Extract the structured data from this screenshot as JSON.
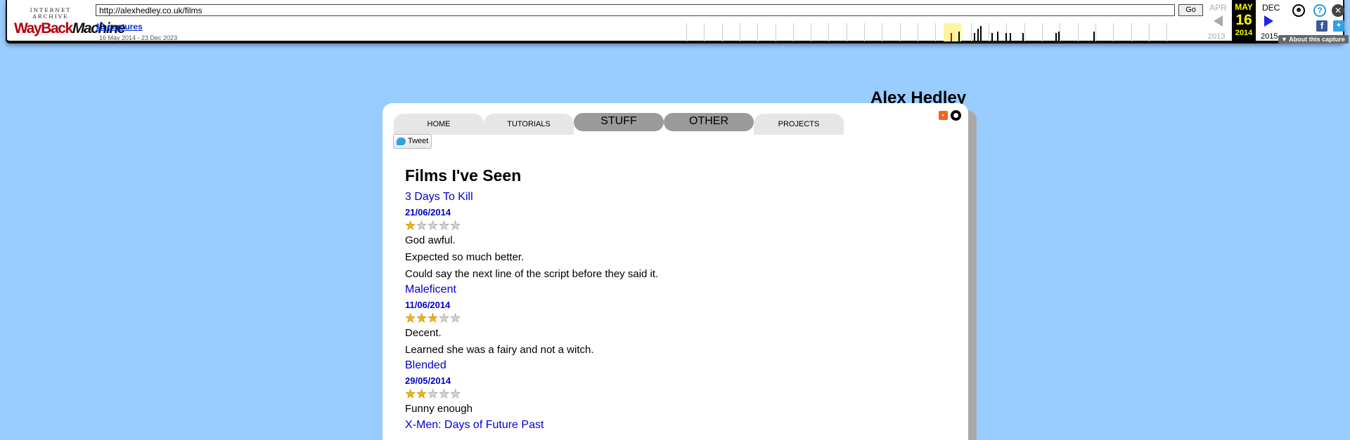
{
  "wayback": {
    "logo_top": "INTERNET ARCHIVE",
    "logo_word1": "WayBack",
    "logo_word2": "Machine",
    "url": "http://alexhedley.co.uk/films",
    "go_label": "Go",
    "captures": "13 captures",
    "range": "16 May 2014 - 23 Dec 2023",
    "prev_month": "APR",
    "current_month": "MAY",
    "current_day": "16",
    "current_year": "2014",
    "next_month": "DEC",
    "prev_year": "2013",
    "next_year": "2015",
    "about": "About this capture",
    "icons": [
      "user-icon",
      "help-icon",
      "close-icon",
      "facebook-icon",
      "twitter-icon"
    ],
    "capture_positions": [
      0.52,
      0.535,
      0.565,
      0.572,
      0.578,
      0.6,
      0.61,
      0.627,
      0.635,
      0.66,
      0.725,
      0.73,
      0.8
    ]
  },
  "site": {
    "title": "Alex Hedley",
    "nav": [
      {
        "label": "HOME"
      },
      {
        "label": "TUTORIALS"
      },
      {
        "label": "STUFF"
      },
      {
        "label": "OTHER"
      },
      {
        "label": "PROJECTS"
      }
    ],
    "tweet": "Tweet"
  },
  "page": {
    "title": "Films I've Seen",
    "films": [
      {
        "title": "3 Days To Kill",
        "date": "21/06/2014",
        "rating": 1,
        "lines": [
          "God awful.",
          "Expected so much better.",
          "Could say the next line of the script before they said it."
        ]
      },
      {
        "title": "Maleficent",
        "date": "11/06/2014",
        "rating": 3,
        "lines": [
          "Decent.",
          "Learned she was a fairy and not a witch."
        ]
      },
      {
        "title": "Blended",
        "date": "29/05/2014",
        "rating": 2,
        "lines": [
          "Funny enough"
        ]
      },
      {
        "title": "X-Men: Days of Future Past",
        "date": "",
        "rating": 0,
        "lines": []
      }
    ]
  },
  "colors": {
    "background": "#99ccff",
    "link": "#0000cc",
    "star_on": "#f4b400"
  }
}
